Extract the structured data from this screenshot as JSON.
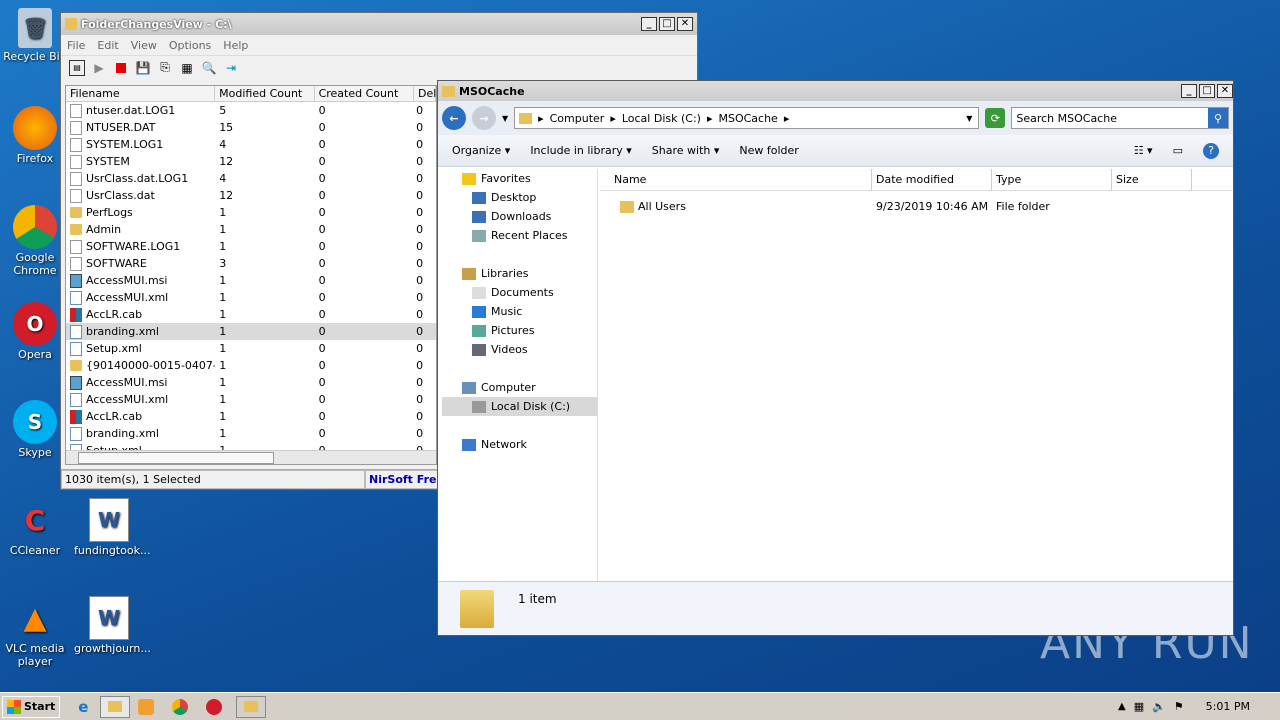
{
  "desktop": {
    "icons": [
      {
        "label": "Recycle Bin",
        "icon": "recycle-bin-icon"
      },
      {
        "label": "Firefox",
        "icon": "firefox-icon"
      },
      {
        "label": "Google Chrome",
        "icon": "chrome-icon"
      },
      {
        "label": "Opera",
        "icon": "opera-icon"
      },
      {
        "label": "Skype",
        "icon": "skype-icon"
      },
      {
        "label": "CCleaner",
        "icon": "ccleaner-icon"
      },
      {
        "label": "VLC media player",
        "icon": "vlc-icon"
      },
      {
        "label": "fundingtook...",
        "icon": "word-doc-icon"
      },
      {
        "label": "growthjourn...",
        "icon": "word-doc-icon"
      }
    ],
    "watermark": "ANY RUN"
  },
  "fcv": {
    "title": "FolderChangesView  -  C:\\",
    "menu": [
      "File",
      "Edit",
      "View",
      "Options",
      "Help"
    ],
    "columns": [
      "Filename",
      "Modified Count",
      "Created Count",
      "Del"
    ],
    "rows": [
      {
        "name": "ntuser.dat.LOG1",
        "mod": "5",
        "cre": "0",
        "del": "0",
        "icon": "doc"
      },
      {
        "name": "NTUSER.DAT",
        "mod": "15",
        "cre": "0",
        "del": "0",
        "icon": "doc"
      },
      {
        "name": "SYSTEM.LOG1",
        "mod": "4",
        "cre": "0",
        "del": "0",
        "icon": "doc"
      },
      {
        "name": "SYSTEM",
        "mod": "12",
        "cre": "0",
        "del": "0",
        "icon": "doc"
      },
      {
        "name": "UsrClass.dat.LOG1",
        "mod": "4",
        "cre": "0",
        "del": "0",
        "icon": "doc"
      },
      {
        "name": "UsrClass.dat",
        "mod": "12",
        "cre": "0",
        "del": "0",
        "icon": "doc"
      },
      {
        "name": "PerfLogs",
        "mod": "1",
        "cre": "0",
        "del": "0",
        "icon": "fold"
      },
      {
        "name": "Admin",
        "mod": "1",
        "cre": "0",
        "del": "0",
        "icon": "fold"
      },
      {
        "name": "SOFTWARE.LOG1",
        "mod": "1",
        "cre": "0",
        "del": "0",
        "icon": "doc"
      },
      {
        "name": "SOFTWARE",
        "mod": "3",
        "cre": "0",
        "del": "0",
        "icon": "doc"
      },
      {
        "name": "AccessMUI.msi",
        "mod": "1",
        "cre": "0",
        "del": "0",
        "icon": "msi"
      },
      {
        "name": "AccessMUI.xml",
        "mod": "1",
        "cre": "0",
        "del": "0",
        "icon": "xml"
      },
      {
        "name": "AccLR.cab",
        "mod": "1",
        "cre": "0",
        "del": "0",
        "icon": "cab"
      },
      {
        "name": "branding.xml",
        "mod": "1",
        "cre": "0",
        "del": "0",
        "icon": "xml",
        "selected": true
      },
      {
        "name": "Setup.xml",
        "mod": "1",
        "cre": "0",
        "del": "0",
        "icon": "xml"
      },
      {
        "name": "{90140000-0015-0407-...",
        "mod": "1",
        "cre": "0",
        "del": "0",
        "icon": "fold"
      },
      {
        "name": "AccessMUI.msi",
        "mod": "1",
        "cre": "0",
        "del": "0",
        "icon": "msi"
      },
      {
        "name": "AccessMUI.xml",
        "mod": "1",
        "cre": "0",
        "del": "0",
        "icon": "xml"
      },
      {
        "name": "AccLR.cab",
        "mod": "1",
        "cre": "0",
        "del": "0",
        "icon": "cab"
      },
      {
        "name": "branding.xml",
        "mod": "1",
        "cre": "0",
        "del": "0",
        "icon": "xml"
      },
      {
        "name": "Setup.xml",
        "mod": "1",
        "cre": "0",
        "del": "0",
        "icon": "xml"
      }
    ],
    "status": "1030 item(s), 1 Selected",
    "brand": "NirSoft Free"
  },
  "exp": {
    "title": "MSOCache",
    "crumbs": [
      "Computer",
      "Local Disk (C:)",
      "MSOCache"
    ],
    "search_placeholder": "Search MSOCache",
    "cmds": [
      "Organize",
      "Include in library",
      "Share with",
      "New folder"
    ],
    "nav": [
      {
        "label": "Favorites",
        "sub": false
      },
      {
        "label": "Desktop",
        "sub": true
      },
      {
        "label": "Downloads",
        "sub": true
      },
      {
        "label": "Recent Places",
        "sub": true
      },
      {
        "label": "",
        "sub": false
      },
      {
        "label": "Libraries",
        "sub": false
      },
      {
        "label": "Documents",
        "sub": true
      },
      {
        "label": "Music",
        "sub": true
      },
      {
        "label": "Pictures",
        "sub": true
      },
      {
        "label": "Videos",
        "sub": true
      },
      {
        "label": "",
        "sub": false
      },
      {
        "label": "Computer",
        "sub": false
      },
      {
        "label": "Local Disk (C:)",
        "sub": true,
        "selected": true
      },
      {
        "label": "",
        "sub": false
      },
      {
        "label": "Network",
        "sub": false
      }
    ],
    "columns": [
      "Name",
      "Date modified",
      "Type",
      "Size"
    ],
    "items": [
      {
        "name": "All Users",
        "date": "9/23/2019 10:46 AM",
        "type": "File folder",
        "size": ""
      }
    ],
    "count": "1 item"
  },
  "taskbar": {
    "start": "Start",
    "time": "5:01 PM"
  }
}
